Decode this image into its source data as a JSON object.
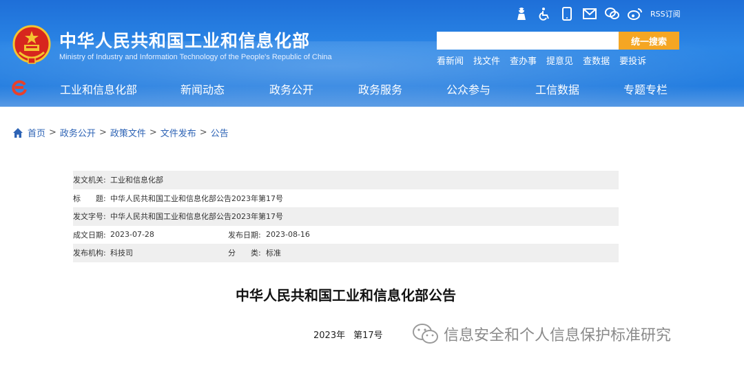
{
  "header": {
    "site_title": "中华人民共和国工业和信息化部",
    "site_subtitle": "Ministry of Industry and Information Technology of the People's Republic of China",
    "rss_label": "RSS订阅",
    "search": {
      "placeholder": "",
      "button_label": "统一搜索"
    },
    "quick_links": [
      "看新闻",
      "找文件",
      "查办事",
      "提意见",
      "查数据",
      "要投诉"
    ],
    "icons": [
      "elder-care-icon",
      "accessibility-icon",
      "mobile-icon",
      "mail-icon",
      "wechat-icon",
      "weibo-icon"
    ],
    "colors": {
      "header_blue": "#1e6fd8",
      "search_orange": "#f5a623",
      "emblem_red": "#d7261e"
    }
  },
  "nav": {
    "items": [
      "工业和信息化部",
      "新闻动态",
      "政务公开",
      "政务服务",
      "公众参与",
      "工信数据",
      "专题专栏"
    ]
  },
  "breadcrumb": {
    "items": [
      "首页",
      "政务公开",
      "政策文件",
      "文件发布",
      "公告"
    ],
    "separator": ">"
  },
  "meta": {
    "issuer_label": "发文机关:",
    "issuer": "工业和信息化部",
    "title_label": "标　　题:",
    "title": "中华人民共和国工业和信息化部公告2023年第17号",
    "doc_no_label": "发文字号:",
    "doc_no": "中华人民共和国工业和信息化部公告2023年第17号",
    "written_label": "成文日期:",
    "written": "2023-07-28",
    "published_label": "发布日期:",
    "published": "2023-08-16",
    "agency_label": "发布机构:",
    "agency": "科技司",
    "category_label": "分　　类:",
    "category": "标准"
  },
  "document": {
    "title": "中华人民共和国工业和信息化部公告",
    "year": "2023年",
    "number": "第17号"
  },
  "watermark": {
    "text": "信息安全和个人信息保护标准研究"
  }
}
